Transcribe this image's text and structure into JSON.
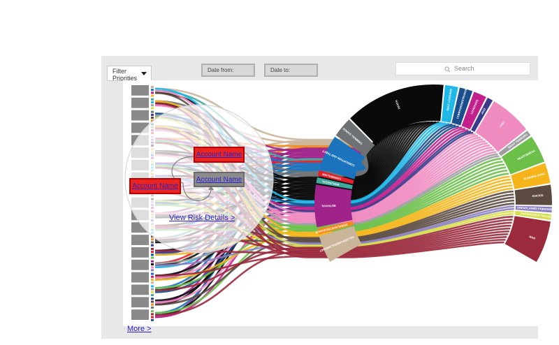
{
  "toolbar": {
    "filter_label": "Filter Priorities",
    "date_from_placeholder": "Date from:",
    "date_to_placeholder": "Date to:",
    "search_placeholder": "Search"
  },
  "overlay": {
    "account_a": "Account Name",
    "account_b": "Account Name",
    "account_c": "Account Name",
    "view_risk_link": "View Risk Details >"
  },
  "footer": {
    "more_link": "More >"
  },
  "colors": {
    "panel_bg": "#e8e8e8",
    "link_blue": "#2a23c8",
    "accent_red": "#e9231f",
    "node_grey": "#8a8a8a"
  },
  "left_nodes_count": 19,
  "arc_segments": [
    {
      "label": "KILLER/FUNERALS/MONEY",
      "color": "#cbb59a",
      "weight": 4
    },
    {
      "label": "SERIAL/SUICIDE/DANCE",
      "color": "#f28a1c",
      "weight": 1
    },
    {
      "label": "BETRAYAL",
      "color": "#a0238a",
      "weight": 6
    },
    {
      "label": "BIOLOGICAL",
      "color": "#42a89e",
      "weight": 1
    },
    {
      "label": "CANNIBALISM",
      "color": "#e0202a",
      "weight": 1
    },
    {
      "label": "CORRUPTION AND THEFT",
      "color": "#1a73bc",
      "weight": 5
    },
    {
      "label": "CRIMINAL GANGS",
      "color": "#6f7274",
      "weight": 3
    },
    {
      "label": "DEATH",
      "color": "#0a0a0a",
      "weight": 14
    },
    {
      "label": "SELF LOATHING",
      "color": "#1fb6e8",
      "weight": 2
    },
    {
      "label": "COMPANION/STRANGER",
      "color": "#1a4e8c",
      "weight": 2
    },
    {
      "label": "LOVE/HATE",
      "color": "#c2208d",
      "weight": 2
    },
    {
      "label": "JAZZ",
      "color": "#3a3a8c",
      "weight": 1
    },
    {
      "label": "LUST",
      "color": "#f08bc0",
      "weight": 6
    },
    {
      "label": "NIGHT TERRORS",
      "color": "#9c9ea0",
      "weight": 1
    },
    {
      "label": "HEARTBREAK",
      "color": "#6cc04a",
      "weight": 4
    },
    {
      "label": "RUNNING SONG",
      "color": "#f5b51a",
      "weight": 3
    },
    {
      "label": "SUICIDE",
      "color": "#5a4a40",
      "weight": 3
    },
    {
      "label": "UNEXPLAINED PHENOMENON",
      "color": "#8a7ec0",
      "weight": 1
    },
    {
      "label": "UNFORESEEN TRAGEDY",
      "color": "#d6dd4a",
      "weight": 1
    },
    {
      "label": "WAR",
      "color": "#9a2a3c",
      "weight": 6
    }
  ]
}
